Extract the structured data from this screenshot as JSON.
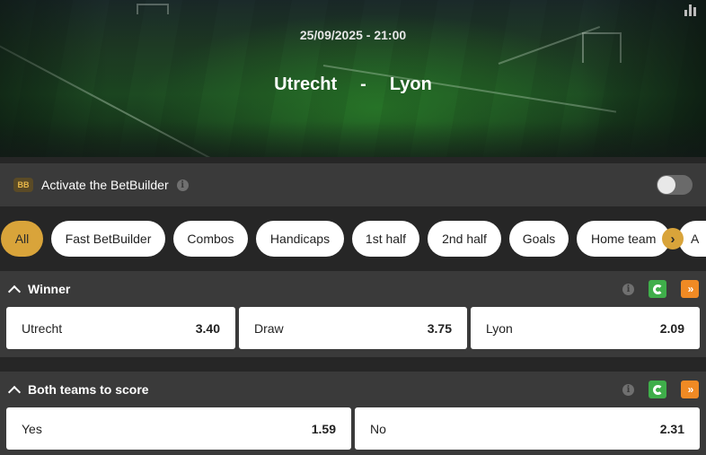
{
  "event": {
    "datetime": "25/09/2025 - 21:00",
    "home_team": "Utrecht",
    "separator": "-",
    "away_team": "Lyon"
  },
  "betbuilder": {
    "badge": "BB",
    "label": "Activate the BetBuilder",
    "info": "i",
    "enabled": false
  },
  "filters": [
    {
      "label": "All",
      "active": true
    },
    {
      "label": "Fast BetBuilder",
      "active": false
    },
    {
      "label": "Combos",
      "active": false
    },
    {
      "label": "Handicaps",
      "active": false
    },
    {
      "label": "1st half",
      "active": false
    },
    {
      "label": "2nd half",
      "active": false
    },
    {
      "label": "Goals",
      "active": false
    },
    {
      "label": "Home team",
      "active": false
    },
    {
      "label": "A",
      "active": false
    }
  ],
  "filters_next": "›",
  "markets": [
    {
      "title": "Winner",
      "info": "i",
      "fast_label": "»",
      "outcomes": [
        {
          "label": "Utrecht",
          "price": "3.40"
        },
        {
          "label": "Draw",
          "price": "3.75"
        },
        {
          "label": "Lyon",
          "price": "2.09"
        }
      ]
    },
    {
      "title": "Both teams to score",
      "info": "i",
      "fast_label": "»",
      "outcomes": [
        {
          "label": "Yes",
          "price": "1.59"
        },
        {
          "label": "No",
          "price": "2.31"
        }
      ]
    }
  ],
  "colors": {
    "accent": "#d9a43a",
    "cashout": "#3fae4a",
    "fast": "#f08a24",
    "panel": "#3a3a3a",
    "background": "#262626"
  }
}
